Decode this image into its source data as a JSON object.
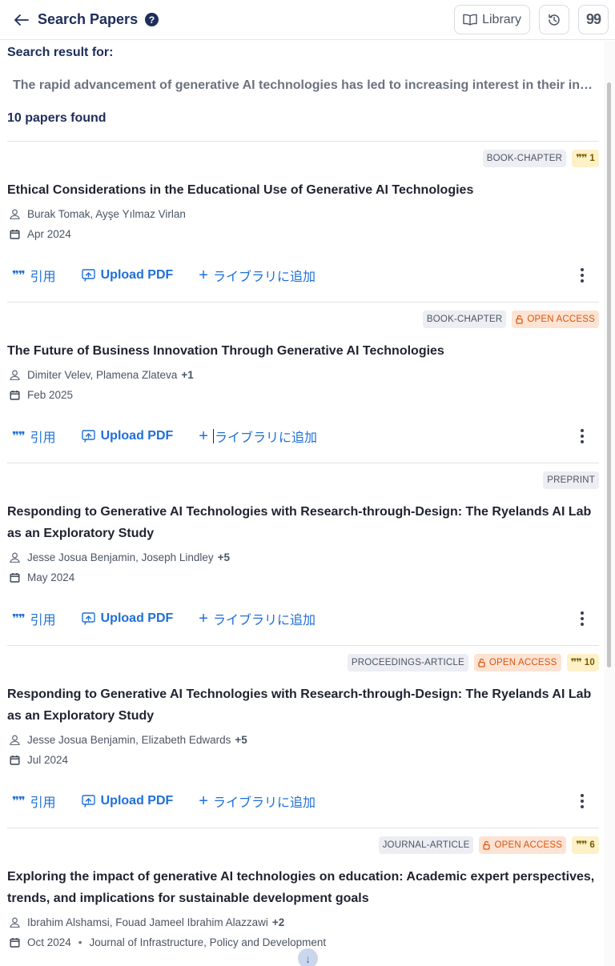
{
  "header": {
    "title": "Search Papers",
    "library_label": "Library",
    "cite_label": "99"
  },
  "search": {
    "label": "Search result for:",
    "query": "The rapid advancement of generative AI technologies has led to increasing interest in their integrat...",
    "found": "10 papers found"
  },
  "actions": {
    "cite": "引用",
    "upload": "Upload PDF",
    "add_library": "ライブラリに追加"
  },
  "papers": [
    {
      "type": "BOOK-CHAPTER",
      "open_access": "",
      "citations": "1",
      "title": "Ethical Considerations in the Educational Use of Generative AI Technologies",
      "authors": "Burak Tomak, Ayşe Yılmaz Virlan",
      "more_authors": "",
      "date": "Apr 2024",
      "venue": ""
    },
    {
      "type": "BOOK-CHAPTER",
      "open_access": "OPEN ACCESS",
      "citations": "",
      "title": "The Future of Business Innovation Through Generative AI Technologies",
      "authors": "Dimiter Velev, Plamena Zlateva",
      "more_authors": "+1",
      "date": "Feb 2025",
      "venue": ""
    },
    {
      "type": "PREPRINT",
      "open_access": "",
      "citations": "",
      "title": "Responding to Generative AI Technologies with Research-through-Design: The Ryelands AI Lab as an Exploratory Study",
      "authors": "Jesse Josua Benjamin, Joseph Lindley",
      "more_authors": "+5",
      "date": "May 2024",
      "venue": ""
    },
    {
      "type": "PROCEEDINGS-ARTICLE",
      "open_access": "OPEN ACCESS",
      "citations": "10",
      "title": "Responding to Generative AI Technologies with Research-through-Design: The Ryelands AI Lab as an Exploratory Study",
      "authors": "Jesse Josua Benjamin, Elizabeth Edwards",
      "more_authors": "+5",
      "date": "Jul 2024",
      "venue": ""
    },
    {
      "type": "JOURNAL-ARTICLE",
      "open_access": "OPEN ACCESS",
      "citations": "6",
      "title": "Exploring the impact of generative AI technologies on education: Academic expert perspectives, trends, and implications for sustainable development goals",
      "authors": "Ibrahim Alshamsi, Fouad Jameel Ibrahim Alazzawi",
      "more_authors": "+2",
      "date": "Oct 2024",
      "venue": "Journal of Infrastructure, Policy and Development"
    }
  ],
  "colors": {
    "navy": "#1e2d5a",
    "link_blue": "#1e6fd9",
    "open_access": "#d9560e",
    "citation_bg": "#fdf1c7"
  },
  "icons": [
    "back-arrow-icon",
    "help-icon",
    "book-icon",
    "history-icon",
    "quote-icon",
    "user-icon",
    "calendar-icon",
    "upload-icon",
    "plus-icon",
    "unlock-icon",
    "more-vertical-icon",
    "arrow-down-icon"
  ]
}
